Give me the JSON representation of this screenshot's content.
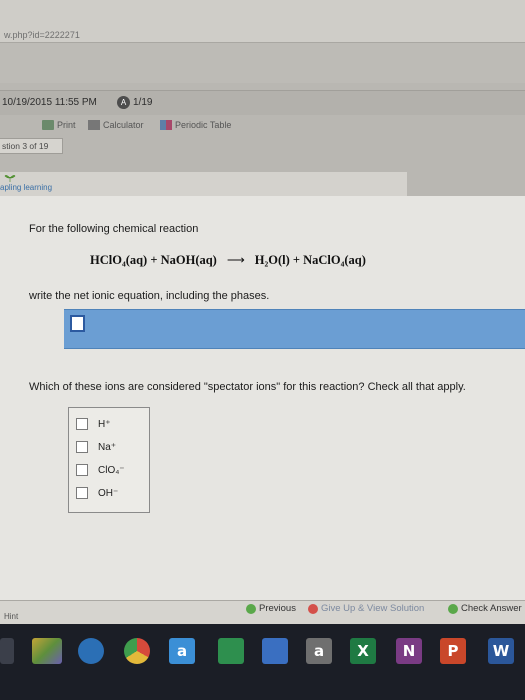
{
  "browser": {
    "url": "w.php?id=2222271"
  },
  "timer": {
    "datetime": "10/19/2015 11:55 PM",
    "badge": "A",
    "progress": "1/19"
  },
  "tools": {
    "print": "Print",
    "calculator": "Calculator",
    "periodic_table": "Periodic Table"
  },
  "question_tab": "stion 3 of 19",
  "brand": {
    "logo_text": "apling learning"
  },
  "question": {
    "intro": "For the following chemical reaction",
    "equation_left": "HClO₄(aq) + NaOH(aq)",
    "equation_arrow": "⟶",
    "equation_right": "H₂O(l) + NaClO₄(aq)",
    "prompt": "write the net ionic equation, including the phases.",
    "spectator_prompt": "Which of these ions are considered \"spectator ions\" for this reaction? Check all that apply.",
    "options": [
      "H⁺",
      "Na⁺",
      "ClO₄⁻",
      "OH⁻"
    ]
  },
  "footer": {
    "hint": "Hint",
    "previous": "Previous",
    "give_up": "Give Up & View Solution",
    "check_answer": "Check Answer"
  },
  "taskbar": {
    "letters": [
      "a",
      "a",
      "X",
      "N",
      "P",
      "W"
    ]
  },
  "colors": {
    "answer_bar": "#6b9ed3",
    "content_bg": "#e6e5e1",
    "check_green": "#5aa84a",
    "giveup_red": "#d4504a"
  }
}
